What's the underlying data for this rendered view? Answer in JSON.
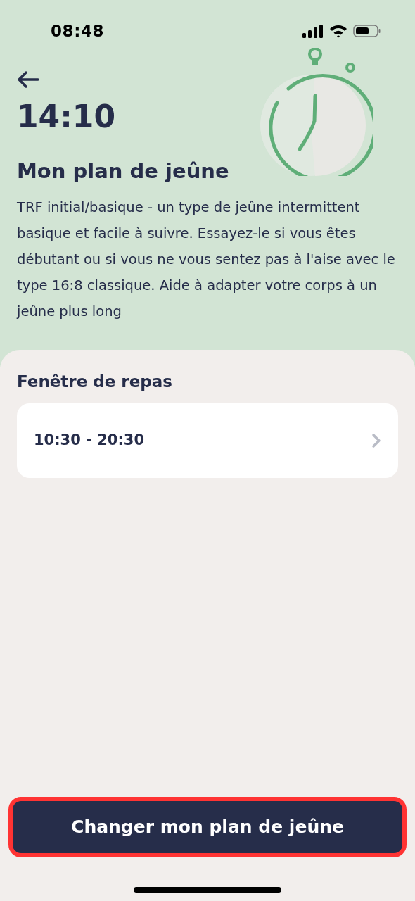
{
  "status_bar": {
    "time": "08:48"
  },
  "header": {
    "time": "14:10",
    "title": "Mon plan de jeûne",
    "description": "TRF initial/basique - un type de jeûne intermittent basique et facile à suivre. Essayez-le si vous êtes débutant ou si vous ne vous sentez pas à l'aise avec le type 16:8 classique. Aide à adapter votre corps à un jeûne plus long"
  },
  "meal_window": {
    "heading": "Fenêtre de repas",
    "value": "10:30 - 20:30"
  },
  "action_button": {
    "label": "Changer mon plan de jeûne",
    "highlighted": true
  }
}
